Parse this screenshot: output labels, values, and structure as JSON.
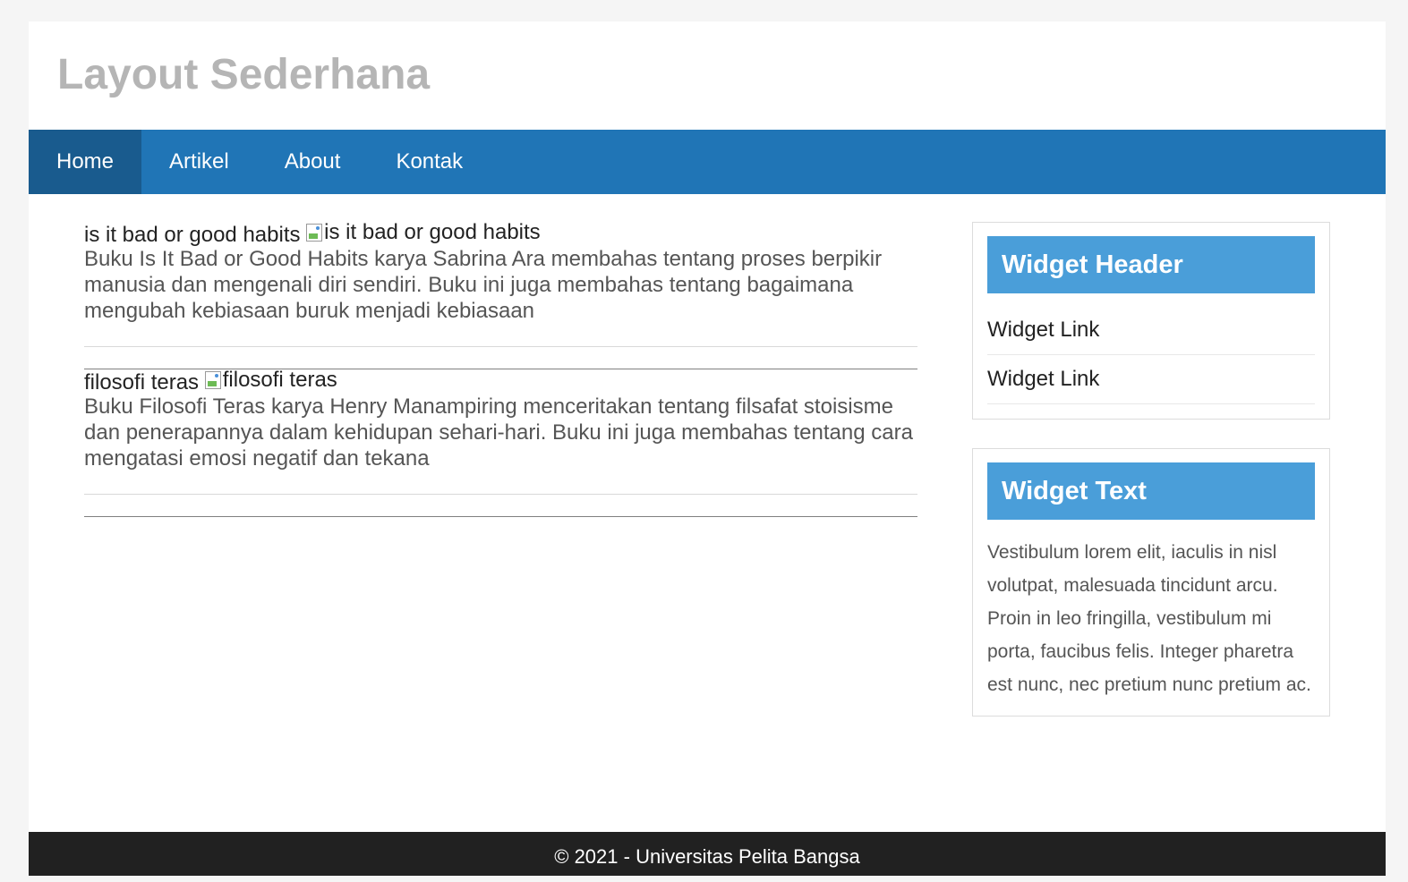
{
  "header": {
    "title": "Layout Sederhana"
  },
  "nav": [
    {
      "label": "Home",
      "active": true
    },
    {
      "label": "Artikel",
      "active": false
    },
    {
      "label": "About",
      "active": false
    },
    {
      "label": "Kontak",
      "active": false
    }
  ],
  "articles": [
    {
      "title": "is it bad or good habits",
      "img_alt": "is it bad or good habits",
      "description": "Buku Is It Bad or Good Habits karya Sabrina Ara membahas tentang proses berpikir manusia dan mengenali diri sendiri. Buku ini juga membahas tentang bagaimana mengubah kebiasaan buruk menjadi kebiasaan"
    },
    {
      "title": "filosofi teras",
      "img_alt": "filosofi teras",
      "description": "Buku Filosofi Teras karya Henry Manampiring menceritakan tentang filsafat stoisisme dan penerapannya dalam kehidupan sehari-hari. Buku ini juga membahas tentang cara mengatasi emosi negatif dan tekana"
    }
  ],
  "sidebar": {
    "widget_header": {
      "title": "Widget Header",
      "links": [
        "Widget Link",
        "Widget Link"
      ]
    },
    "widget_text": {
      "title": "Widget Text",
      "text": "Vestibulum lorem elit, iaculis in nisl volutpat, malesuada tincidunt arcu. Proin in leo fringilla, vestibulum mi porta, faucibus felis. Integer pharetra est nunc, nec pretium nunc pretium ac."
    }
  },
  "footer": {
    "text": "© 2021 - Universitas Pelita Bangsa"
  },
  "colors": {
    "nav_bg": "#2075b6",
    "nav_active": "#195b8e",
    "widget_header_bg": "#4a9ed9",
    "footer_bg": "#212121",
    "title_gray": "#b5b5b5"
  }
}
